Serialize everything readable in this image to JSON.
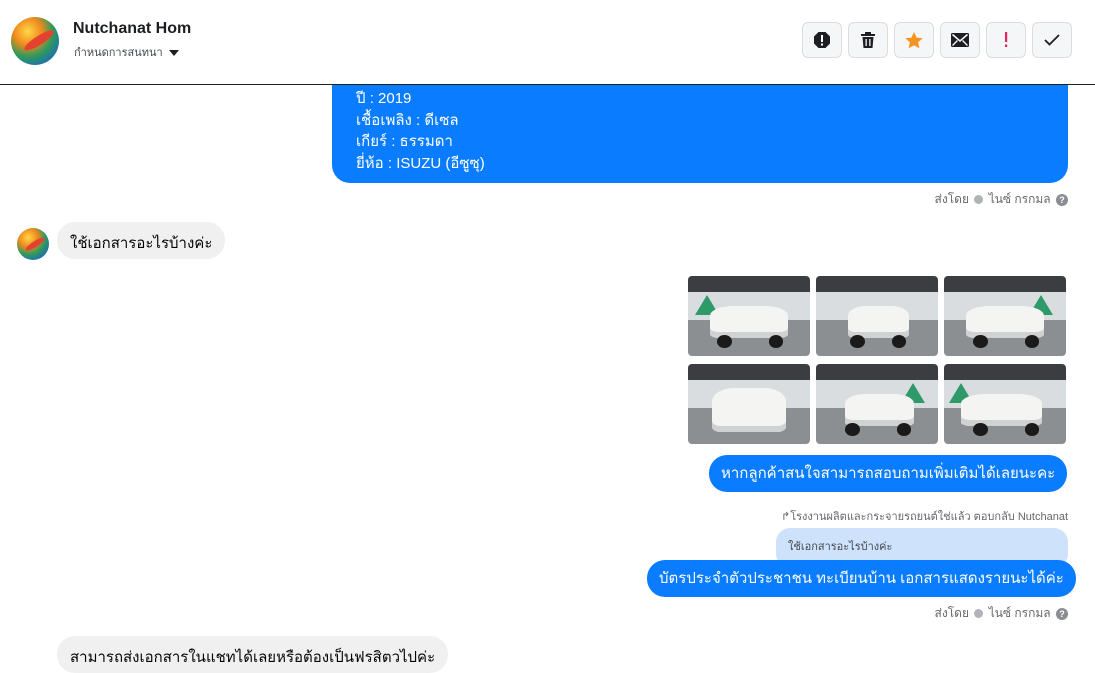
{
  "header": {
    "contact_name": "Nutchanat Hom",
    "assign_label": "กำหนดการสนทนา",
    "actions": [
      {
        "name": "report-icon"
      },
      {
        "name": "trash-icon"
      },
      {
        "name": "star-icon",
        "color": "#f7931e"
      },
      {
        "name": "mail-icon"
      },
      {
        "name": "exclamation-icon",
        "color": "#e0245e"
      },
      {
        "name": "checkmark-icon"
      }
    ]
  },
  "messages": {
    "details": {
      "lines": [
        "ปี : 2019",
        "เชื้อเพลิง : ดีเซล",
        "เกียร์ : ธรรมดา",
        "ยี่ห้อ : ISUZU (อีซูซุ)"
      ]
    },
    "sent_by_1": {
      "prefix": "ส่งโดย",
      "name": "ไนซ์ กรกมล"
    },
    "customer_question": "ใช้เอกสารอะไรบ้างค่ะ",
    "interest_msg": "หากลูกค้าสนใจสามารถสอบถามเพิ่มเติมได้เลยนะคะ",
    "reply_note": "โรงงานผลิตและกระจายรถยนต์ใช่แล้ว ตอบกลับ Nutchanat",
    "quoted_text": "ใช้เอกสารอะไรบ้างค่ะ",
    "documents_answer": "บัตรประจำตัวประชาชน ทะเบียนบ้าน เอกสารแสดงรายนะได้ค่ะ",
    "sent_by_2": {
      "prefix": "ส่งโดย",
      "name": "ไนซ์ กรกมล"
    },
    "customer_followup_partial": "สามารถส่งเอกสารในแชทได้เลยหรือต้องเป็นฟรสิตวไปค่ะ"
  },
  "colors": {
    "accent": "#0a7cff",
    "gray_bubble": "#f0f0f0",
    "quoted_bg": "#cfe2fb"
  }
}
